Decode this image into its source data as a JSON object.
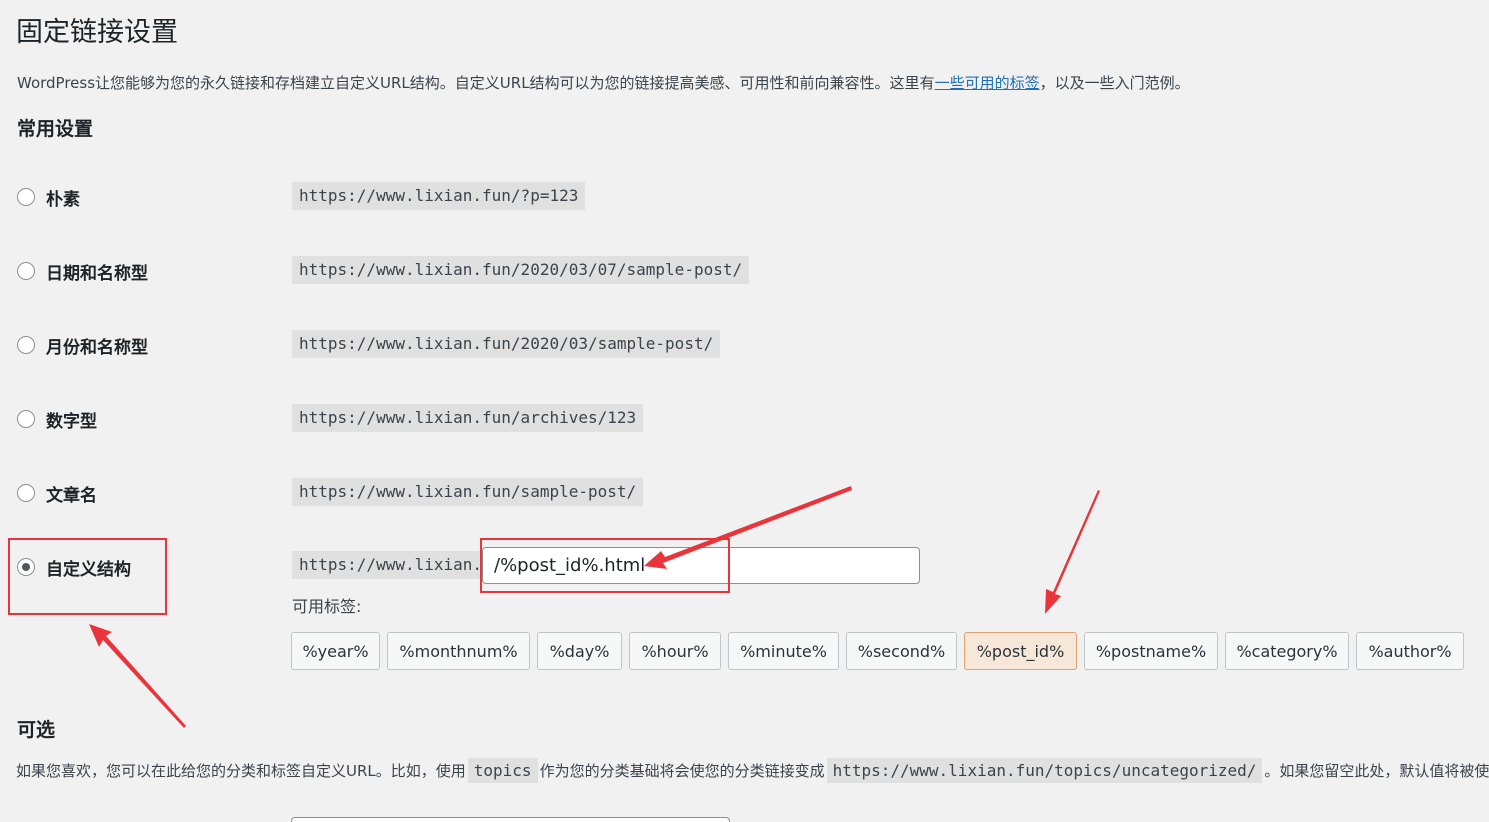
{
  "page": {
    "title": "固定链接设置",
    "intro_before": "WordPress让您能够为您的永久链接和存档建立自定义URL结构。自定义URL结构可以为您的链接提高美感、可用性和前向兼容性。这里有",
    "intro_link": "一些可用的标签",
    "intro_after": "，以及一些入门范例。"
  },
  "common_settings": {
    "heading": "常用设置",
    "options": [
      {
        "label": "朴素",
        "example": "https://www.lixian.fun/?p=123",
        "checked": false
      },
      {
        "label": "日期和名称型",
        "example": "https://www.lixian.fun/2020/03/07/sample-post/",
        "checked": false
      },
      {
        "label": "月份和名称型",
        "example": "https://www.lixian.fun/2020/03/sample-post/",
        "checked": false
      },
      {
        "label": "数字型",
        "example": "https://www.lixian.fun/archives/123",
        "checked": false
      },
      {
        "label": "文章名",
        "example": "https://www.lixian.fun/sample-post/",
        "checked": false
      }
    ],
    "custom": {
      "label": "自定义结构",
      "checked": true,
      "base_url": "https://www.lixian.fun",
      "value": "/%post_id%.html"
    },
    "available_tags_label": "可用标签:",
    "tags": [
      "%year%",
      "%monthnum%",
      "%day%",
      "%hour%",
      "%minute%",
      "%second%",
      "%post_id%",
      "%postname%",
      "%category%",
      "%author%"
    ],
    "active_tag": "%post_id%"
  },
  "optional": {
    "heading": "可选",
    "desc_1": "如果您喜欢，您可以在此给您的分类和标签自定义URL。比如，使用",
    "code_1": "topics",
    "desc_2": "作为您的分类基础将会使您的分类链接变成",
    "code_2": "https://www.lixian.fun/topics/uncategorized/",
    "desc_3": "。如果您留空此处，默认值将被使用"
  },
  "colors": {
    "annotation": "#e8343a",
    "link": "#2271b1",
    "code_bg": "#e0e0e0"
  }
}
